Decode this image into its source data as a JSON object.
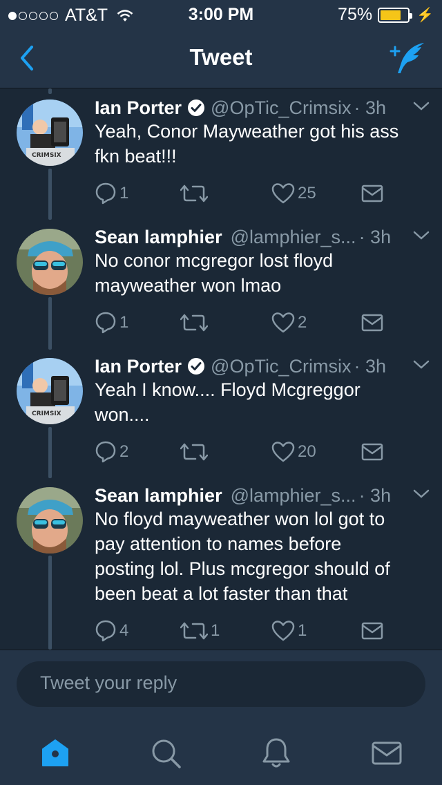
{
  "status_bar": {
    "carrier": "AT&T",
    "time": "3:00 PM",
    "battery_percent": "75%",
    "battery_level": 0.75,
    "signal_bars": 1
  },
  "nav": {
    "title": "Tweet",
    "back_icon": "chevron-left-icon",
    "compose_icon": "compose-tweet-icon"
  },
  "colors": {
    "background": "#1b2836",
    "bar": "#243447",
    "accent": "#1da1f2",
    "muted": "#8899a6",
    "battery": "#f5c518"
  },
  "tweets": [
    {
      "name": "Ian Porter",
      "verified": true,
      "handle": "@OpTic_Crimsix",
      "time": "· 3h",
      "lines": [
        "Yeah, Conor Mayweather got his ass",
        "fkn beat!!!"
      ],
      "replies": "1",
      "retweets": "",
      "likes": "25"
    },
    {
      "name": "Sean lamphier",
      "verified": false,
      "handle": "@lamphier_s...",
      "time": "· 3h",
      "lines": [
        "No conor mcgregor lost floyd",
        "mayweather won lmao"
      ],
      "replies": "1",
      "retweets": "",
      "likes": "2"
    },
    {
      "name": "Ian Porter",
      "verified": true,
      "handle": "@OpTic_Crimsix",
      "time": "· 3h",
      "lines": [
        "Yeah I know.... Floyd Mcgreggor",
        "won...."
      ],
      "replies": "2",
      "retweets": "",
      "likes": "20"
    },
    {
      "name": "Sean lamphier",
      "verified": false,
      "handle": "@lamphier_s...",
      "time": "· 3h",
      "lines": [
        "No floyd mayweather won lol got to",
        "pay attention to names before",
        "posting lol. Plus mcgregor should of",
        "been beat a lot faster than that"
      ],
      "replies": "4",
      "retweets": "1",
      "likes": "1"
    }
  ],
  "reply": {
    "placeholder": "Tweet your reply"
  },
  "tabs": [
    {
      "name": "home",
      "icon": "home-icon",
      "active": true
    },
    {
      "name": "search",
      "icon": "search-icon",
      "active": false
    },
    {
      "name": "notifications",
      "icon": "bell-icon",
      "active": false
    },
    {
      "name": "messages",
      "icon": "mail-icon",
      "active": false
    }
  ]
}
